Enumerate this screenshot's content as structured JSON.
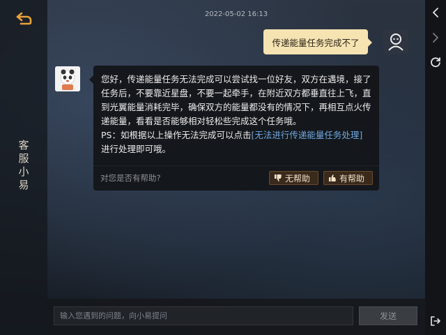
{
  "sidebar": {
    "agent_name": "客服小易"
  },
  "chat": {
    "timestamp": "2022-05-02 16:13",
    "user_message": "传递能量任务完成不了",
    "bot_message": {
      "text": "您好，传递能量任务无法完成可以尝试找一位好友，双方在遇境，接了任务后，不要靠近星盘，不要一起牵手，在附近双方都垂直往上飞，直到光翼能量消耗完毕，确保双方的能量都没有的情况下，再相互点火传递能量，看看是否能够相对轻松些完成这个任务哦。",
      "ps_prefix": "PS：如根据以上操作无法完成可以点击",
      "link_text": "[无法进行传递能量任务处理]",
      "ps_suffix": "进行处理即可哦。"
    },
    "feedback": {
      "question": "对您是否有帮助?",
      "not_helpful_label": "无帮助",
      "helpful_label": "有帮助"
    }
  },
  "input": {
    "placeholder": "输入您遇到的问题，向小易提问",
    "value": ""
  },
  "send_label": "发送",
  "icons": {
    "back": "back-arrow-icon",
    "nav_back": "chevron-left-icon",
    "nav_forward": "chevron-right-icon",
    "reload": "reload-icon",
    "exit": "exit-icon",
    "thumbs_down": "thumbs-down-icon",
    "thumbs_up": "thumbs-up-icon"
  },
  "colors": {
    "accent_orange": "#e8a33a",
    "user_bubble": "#f6e3b2",
    "link_blue": "#6fa8e0",
    "feedback_button": "#3a2a1c"
  }
}
